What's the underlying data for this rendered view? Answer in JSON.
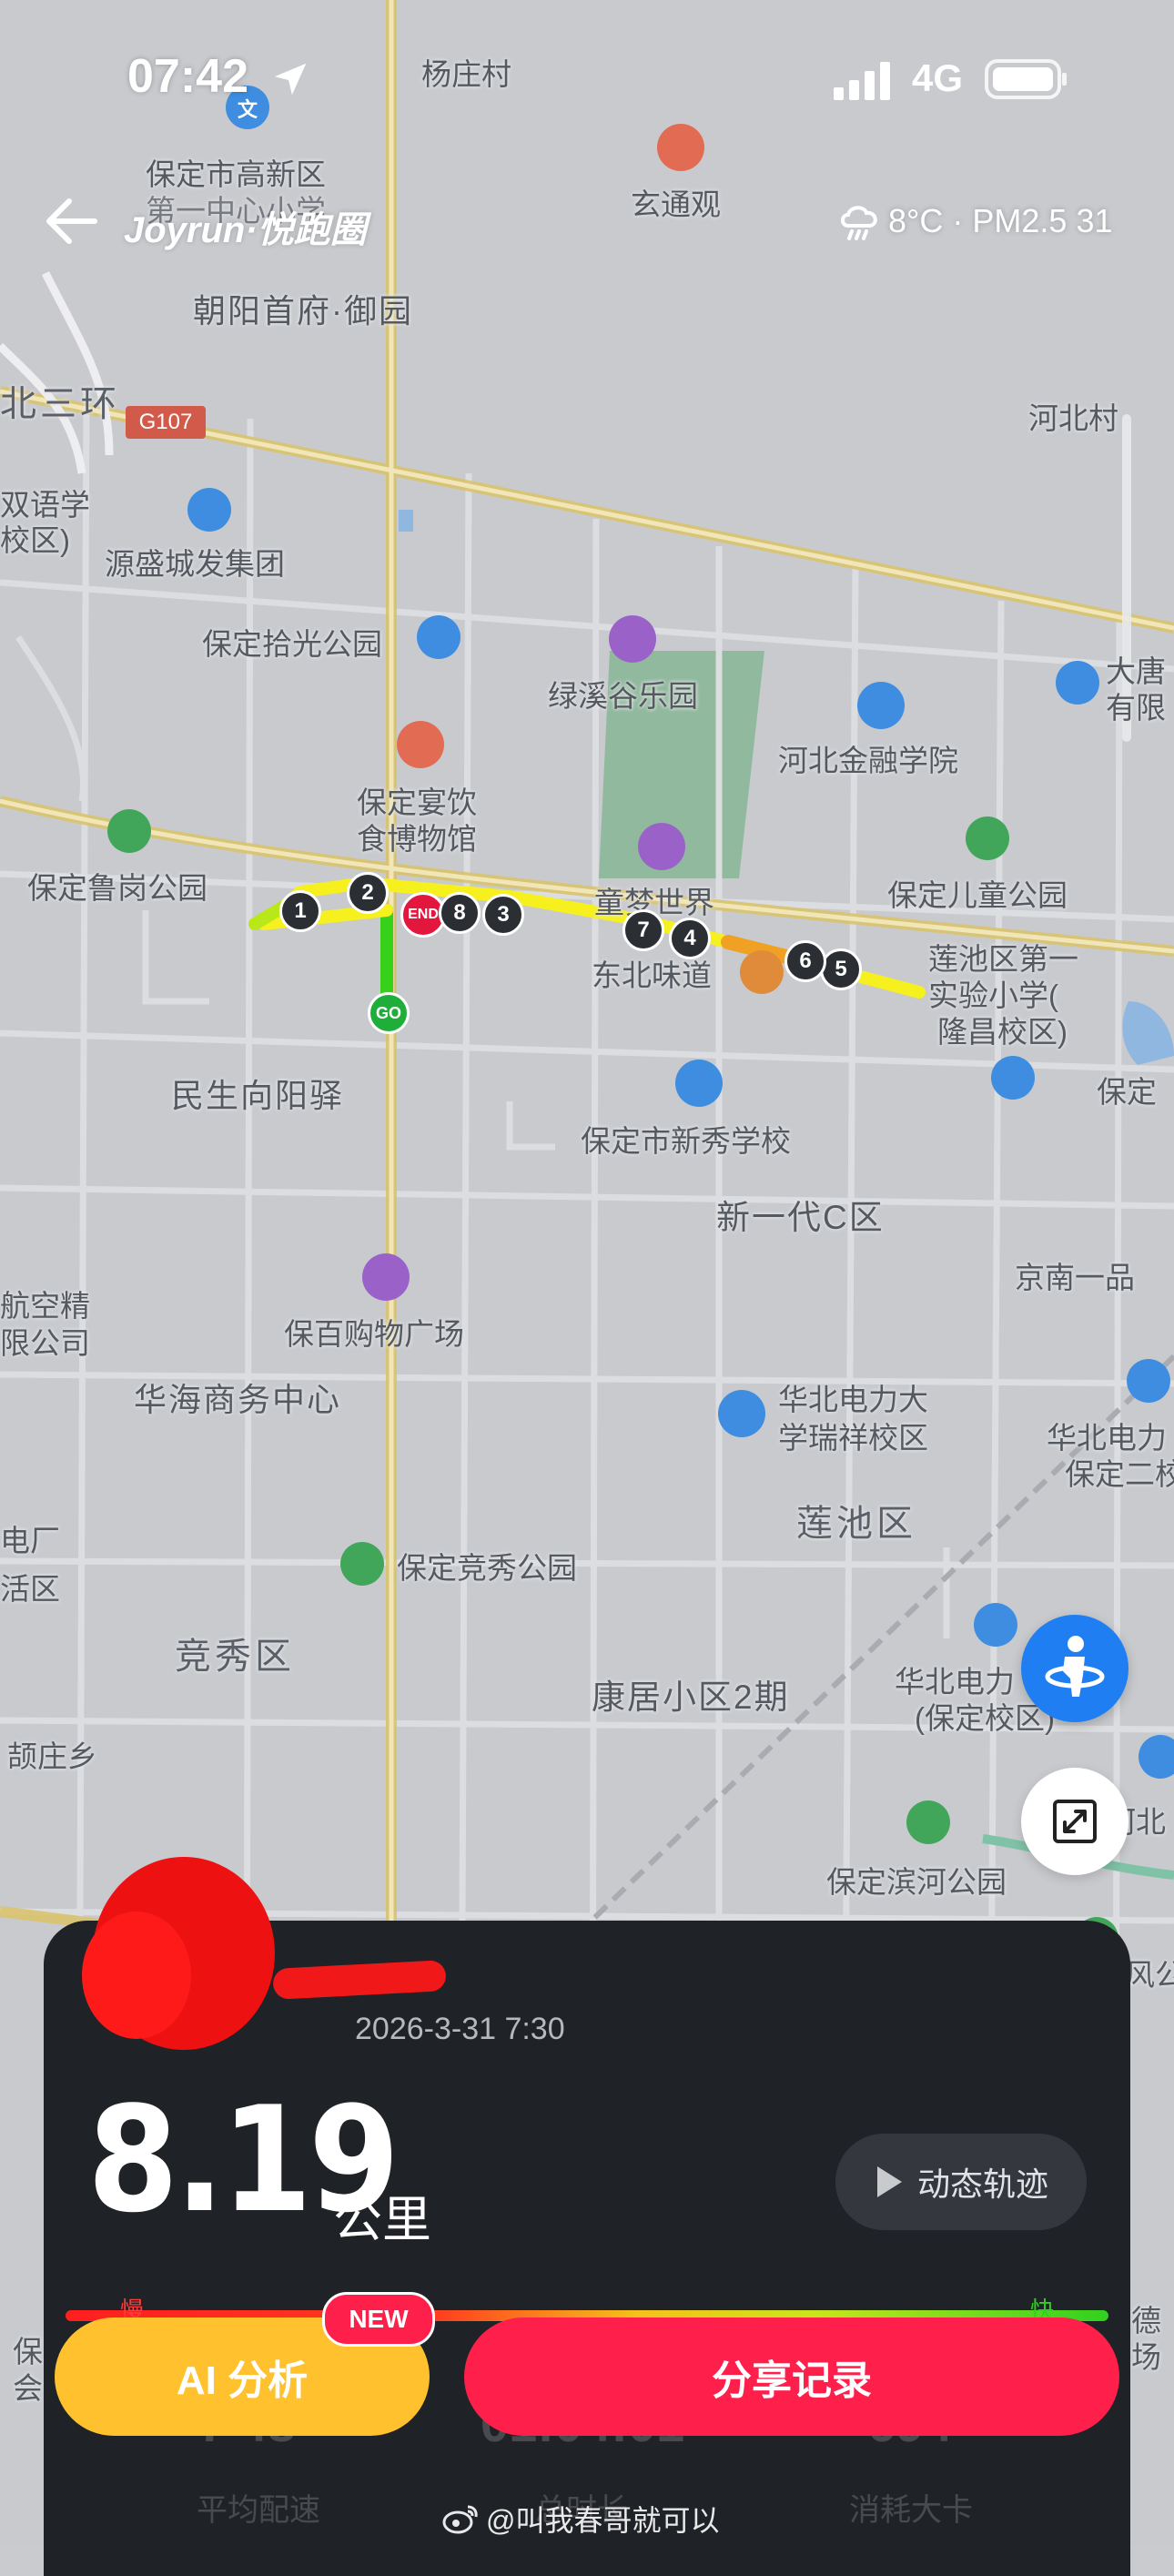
{
  "status_bar": {
    "time": "07:42",
    "network": "4G"
  },
  "header": {
    "brand": "Joyrun·悦跑圈",
    "weather": "8°C · PM2.5 31"
  },
  "map": {
    "labels": [
      {
        "text": "杨庄村"
      },
      {
        "text": "保定市高新区"
      },
      {
        "text": "第一中心小学"
      },
      {
        "text": "玄通观"
      },
      {
        "text": "朝阳首府·御园"
      },
      {
        "text": "北三环"
      },
      {
        "text": "G107"
      },
      {
        "text": "河北村"
      },
      {
        "text": "双语学"
      },
      {
        "text": "校区)"
      },
      {
        "text": "源盛城发集团"
      },
      {
        "text": "保定拾光公园"
      },
      {
        "text": "绿溪谷乐园"
      },
      {
        "text": "大唐"
      },
      {
        "text": "有限"
      },
      {
        "text": "河北金融学院"
      },
      {
        "text": "保定宴饮"
      },
      {
        "text": "食博物馆"
      },
      {
        "text": "保定鲁岗公园"
      },
      {
        "text": "童梦世界"
      },
      {
        "text": "保定儿童公园"
      },
      {
        "text": "东北味道"
      },
      {
        "text": "莲池区第一"
      },
      {
        "text": "实验小学("
      },
      {
        "text": "隆昌校区)"
      },
      {
        "text": "民生向阳驿"
      },
      {
        "text": "保定市新秀学校"
      },
      {
        "text": "保定"
      },
      {
        "text": "新一代C区"
      },
      {
        "text": "京南一品"
      },
      {
        "text": "航空精"
      },
      {
        "text": "限公司"
      },
      {
        "text": "保百购物广场"
      },
      {
        "text": "华海商务中心"
      },
      {
        "text": "华北电力大"
      },
      {
        "text": "学瑞祥校区"
      },
      {
        "text": "华北电力"
      },
      {
        "text": "保定二校"
      },
      {
        "text": "电厂"
      },
      {
        "text": "活区"
      },
      {
        "text": "保定竞秀公园"
      },
      {
        "text": "莲池区"
      },
      {
        "text": "竞秀区"
      },
      {
        "text": "康居小区2期"
      },
      {
        "text": "华北电力"
      },
      {
        "text": "(保定校区)"
      },
      {
        "text": "颉庄乡"
      },
      {
        "text": "河北"
      },
      {
        "text": "保定滨河公园"
      },
      {
        "text": "风公"
      },
      {
        "text": "德"
      },
      {
        "text": "场"
      },
      {
        "text": "保"
      },
      {
        "text": "会"
      }
    ],
    "markers": {
      "start": "GO",
      "end": "END",
      "km": [
        "1",
        "2",
        "3",
        "4",
        "5",
        "6",
        "7",
        "8"
      ]
    }
  },
  "run": {
    "date": "2026-3-31 7:30",
    "distance": "8.19",
    "unit": "公里",
    "replay_label": "动态轨迹",
    "pace_slow": "慢",
    "pace_fast": "快",
    "stats": [
      {
        "value": "7'48\"",
        "label": "平均配速"
      },
      {
        "value": "01:04:01",
        "label": "总时长"
      },
      {
        "value": "694",
        "label": "消耗大卡"
      }
    ]
  },
  "actions": {
    "ai_label": "AI 分析",
    "new_badge": "NEW",
    "share_label": "分享记录"
  },
  "watermark": "@叫我春哥就可以",
  "colors": {
    "accent_red": "#ff1f4b",
    "accent_yellow": "#ffc22e",
    "panel_bg": "#1f2226",
    "route_green": "#36d11b",
    "route_yellow": "#f5f01e"
  }
}
